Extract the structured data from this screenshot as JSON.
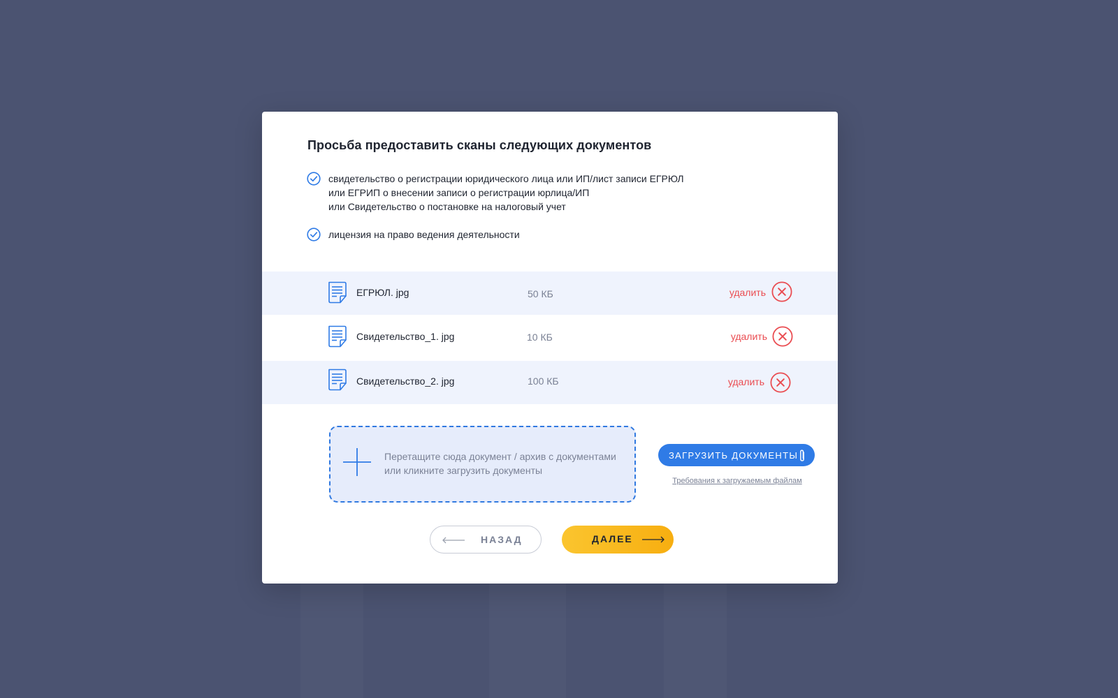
{
  "modal": {
    "title": "Просьба предоставить сканы следующих документов",
    "requirements": [
      {
        "lines": [
          "свидетельство о регистрации юридического лица или ИП/лист записи ЕГРЮЛ",
          "или ЕГРИП о внесении записи о регистрации юрлица/ИП",
          "или Свидетельство о постановке на налоговый учет"
        ]
      },
      {
        "lines": [
          "лицензия на право ведения деятельности"
        ]
      }
    ],
    "files": [
      {
        "name": "ЕГРЮЛ. jpg",
        "size": "50 КБ",
        "delete_label": "удалить"
      },
      {
        "name": "Свидетельство_1. jpg",
        "size": "10 КБ",
        "delete_label": "удалить"
      },
      {
        "name": "Свидетельство_2. jpg",
        "size": "100 КБ",
        "delete_label": "удалить"
      }
    ],
    "dropzone": {
      "line1": "Перетащите сюда документ / архив с документами",
      "line2": "или кликните загрузить документы"
    },
    "upload_button": "ЗАГРУЗИТЬ ДОКУМЕНТЫ",
    "requirements_link": "Требования к загружаемым файлам",
    "back_button": "НАЗАД",
    "next_button": "ДАЛЕЕ"
  },
  "colors": {
    "background": "#4b5371",
    "accent_blue": "#2f7be6",
    "delete_red": "#ea4d52",
    "next_yellow": "#fbc52f",
    "row_shade": "#eff3fd"
  },
  "icons": {
    "requirement": "check-circle-icon",
    "file": "document-icon",
    "delete": "close-circle-icon",
    "dropzone": "plus-icon",
    "upload": "paperclip-icon",
    "back": "arrow-left-icon",
    "next": "arrow-right-icon"
  }
}
